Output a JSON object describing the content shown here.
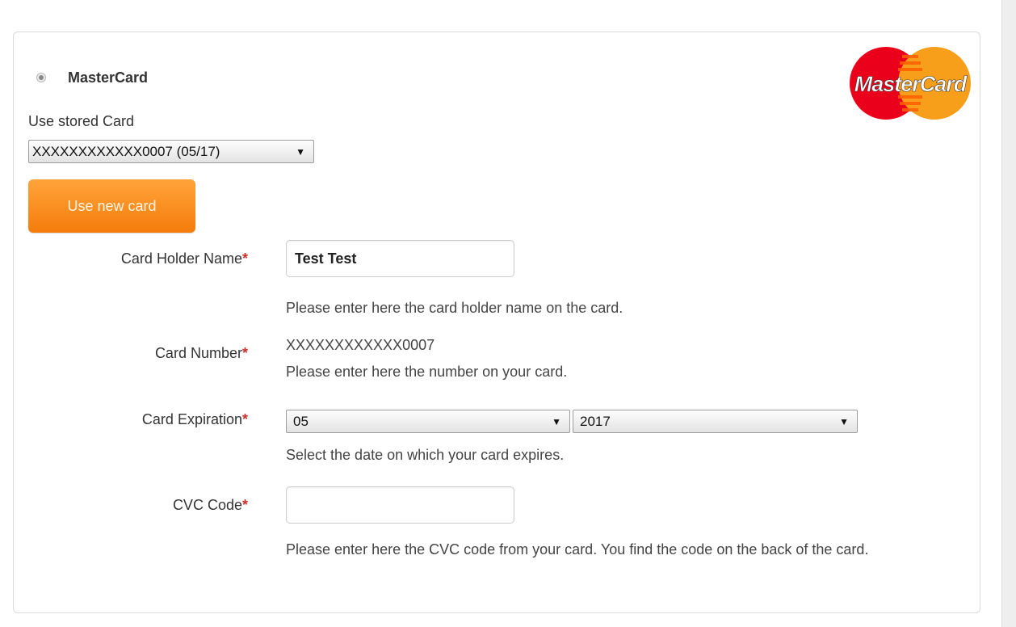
{
  "payment_method": {
    "label": "MasterCard",
    "logo_text": "MasterCard",
    "icon": "mastercard-logo-icon",
    "selected": true
  },
  "stored_card": {
    "label": "Use stored Card",
    "selected_value": "XXXXXXXXXXXX0007 (05/17)"
  },
  "new_card_button": {
    "label": "Use new card"
  },
  "fields": {
    "card_holder": {
      "label": "Card Holder Name",
      "required_mark": "*",
      "value": "Test Test",
      "help": "Please enter here the card holder name on the card."
    },
    "card_number": {
      "label": "Card Number",
      "required_mark": "*",
      "value": "XXXXXXXXXXXX0007",
      "help": "Please enter here the number on your card."
    },
    "card_expiration": {
      "label": "Card Expiration",
      "required_mark": "*",
      "month": "05",
      "year": "2017",
      "help": "Select the date on which your card expires."
    },
    "cvc": {
      "label": "CVC Code",
      "required_mark": "*",
      "value": "",
      "help": "Please enter here the CVC code from your card. You find the code on the back of the card."
    }
  },
  "colors": {
    "button_orange": "#f57c0b",
    "required_red": "#c9302c",
    "mastercard_red": "#eb001b",
    "mastercard_orange": "#f79e1b"
  }
}
